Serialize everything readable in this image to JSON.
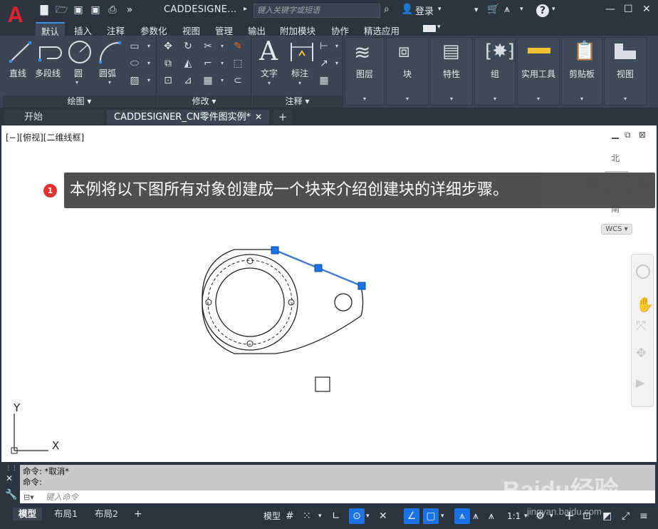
{
  "app": {
    "logo": "A",
    "title": "CADDESIGNE...",
    "search_placeholder": "键入关键字或短语",
    "login": "登录"
  },
  "menus": [
    "默认",
    "插入",
    "注释",
    "参数化",
    "视图",
    "管理",
    "输出",
    "附加模块",
    "协作",
    "精选应用"
  ],
  "ribbon": {
    "draw": {
      "line": "直线",
      "polyline": "多段线",
      "circle": "圆",
      "arc": "圆弧",
      "title": "绘图"
    },
    "modify": {
      "title": "修改"
    },
    "annotate": {
      "text": "文字",
      "dimension": "标注",
      "title": "注释"
    },
    "big": [
      "图层",
      "块",
      "特性",
      "组",
      "实用工具",
      "剪贴板",
      "视图"
    ]
  },
  "file_tabs": {
    "start": "开始",
    "doc": "CADDESIGNER_CN零件图实例*"
  },
  "viewport": {
    "label": "[−][俯视][二维线框]",
    "compass": {
      "n": "北",
      "e": "东",
      "s": "南",
      "w": "西"
    },
    "wcs": "WCS",
    "ucs_y": "Y",
    "ucs_x": "X"
  },
  "tooltip": {
    "badge": "1",
    "text": "本例将以下图所有对象创建成一个块来介绍创建块的详细步骤。"
  },
  "command": {
    "line1": "命令: *取消*",
    "line2": "命令:",
    "placeholder": "键入命令"
  },
  "status": {
    "model_tab": "模型",
    "layout1": "布局1",
    "layout2": "布局2",
    "model_btn": "模型",
    "scale": "1:1"
  },
  "watermark": {
    "brand": "Baidu经验",
    "url": "jingyan.baidu.com"
  }
}
